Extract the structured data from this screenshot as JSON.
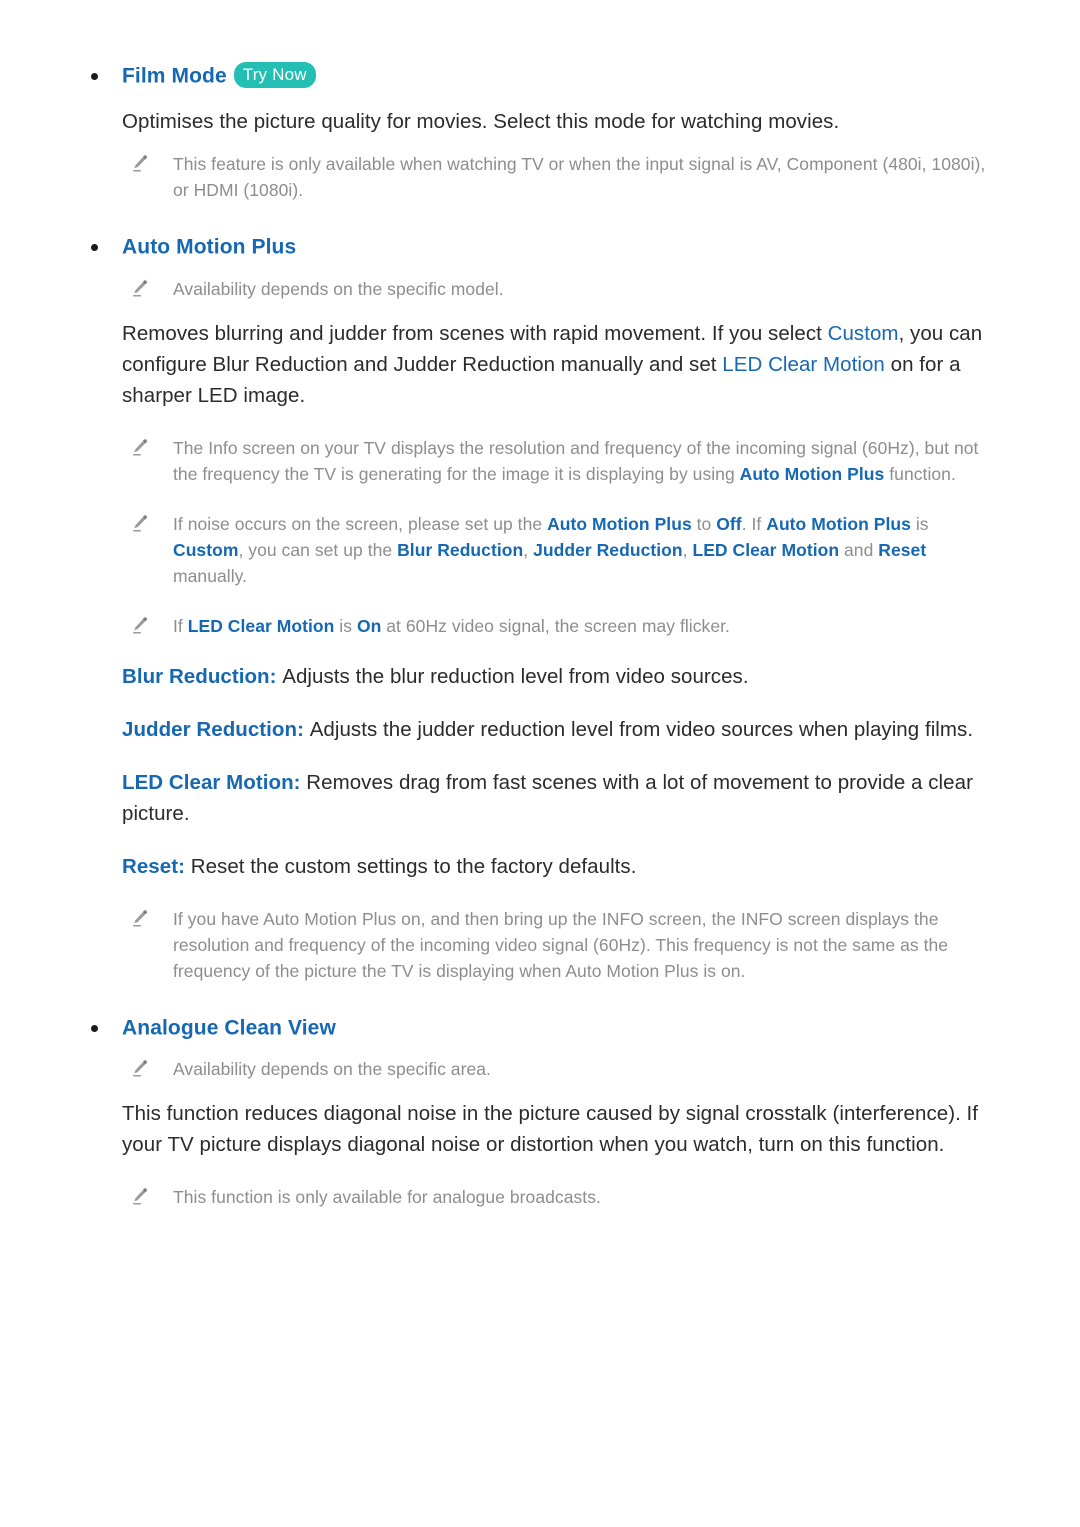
{
  "document": {
    "type": "tv-e-manual-page",
    "colors": {
      "accent_blue": "#1668b3",
      "badge_teal": "#23bfb3",
      "body_text": "#2b2b2b",
      "note_text": "#8d8d8d",
      "background": "#ffffff"
    }
  },
  "sections": [
    {
      "id": "film-mode",
      "heading": "Film Mode",
      "badge": "Try Now",
      "badge_icon": "try-now-badge",
      "body": "Optimises the picture quality for movies. Select this mode for watching movies.",
      "notes": [
        {
          "icon": "pencil-note-icon",
          "parts": [
            {
              "text": "This feature is only available when watching TV or when the input signal is AV, Component (480i, 1080i), or HDMI (1080i).",
              "style": "plain"
            }
          ]
        }
      ]
    },
    {
      "id": "auto-motion-plus",
      "heading": "Auto Motion Plus",
      "badge": null,
      "pre_notes": [
        {
          "icon": "pencil-note-icon",
          "parts": [
            {
              "text": "Availability depends on the specific model.",
              "style": "plain"
            }
          ]
        }
      ],
      "body_parts": [
        {
          "text": "Removes blurring and judder from scenes with rapid movement. If you select ",
          "style": "plain"
        },
        {
          "text": "Custom",
          "style": "blue"
        },
        {
          "text": ", you can configure Blur Reduction and Judder Reduction manually and set ",
          "style": "plain"
        },
        {
          "text": "LED Clear Motion",
          "style": "blue"
        },
        {
          "text": " on for a sharper LED image.",
          "style": "plain"
        }
      ],
      "notes": [
        {
          "icon": "pencil-note-icon",
          "parts": [
            {
              "text": "The Info screen on your TV displays the resolution and frequency of the incoming signal (60Hz), but not the frequency the TV is generating for the image it is displaying by using ",
              "style": "plain"
            },
            {
              "text": "Auto Motion Plus",
              "style": "blue-bold"
            },
            {
              "text": " function.",
              "style": "plain"
            }
          ]
        },
        {
          "icon": "pencil-note-icon",
          "parts": [
            {
              "text": "If noise occurs on the screen, please set up the ",
              "style": "plain"
            },
            {
              "text": "Auto Motion Plus",
              "style": "blue-bold"
            },
            {
              "text": " to ",
              "style": "plain"
            },
            {
              "text": "Off",
              "style": "blue-bold"
            },
            {
              "text": ". If ",
              "style": "plain"
            },
            {
              "text": "Auto Motion Plus",
              "style": "blue-bold"
            },
            {
              "text": " is ",
              "style": "plain"
            },
            {
              "text": "Custom",
              "style": "blue-bold"
            },
            {
              "text": ", you can set up the ",
              "style": "plain"
            },
            {
              "text": "Blur Reduction",
              "style": "blue-bold"
            },
            {
              "text": ", ",
              "style": "plain"
            },
            {
              "text": "Judder Reduction",
              "style": "blue-bold"
            },
            {
              "text": ", ",
              "style": "plain"
            },
            {
              "text": "LED Clear Motion",
              "style": "blue-bold"
            },
            {
              "text": " and ",
              "style": "plain"
            },
            {
              "text": "Reset",
              "style": "blue-bold"
            },
            {
              "text": " manually.",
              "style": "plain"
            }
          ]
        },
        {
          "icon": "pencil-note-icon",
          "parts": [
            {
              "text": "If ",
              "style": "plain"
            },
            {
              "text": "LED Clear Motion",
              "style": "blue-bold"
            },
            {
              "text": " is ",
              "style": "plain"
            },
            {
              "text": "On",
              "style": "blue-bold"
            },
            {
              "text": " at 60Hz video signal, the screen may flicker.",
              "style": "plain"
            }
          ]
        }
      ],
      "definitions": [
        {
          "term": "Blur Reduction",
          "separator": ": ",
          "description": "Adjusts the blur reduction level from video sources."
        },
        {
          "term": "Judder Reduction",
          "separator": ": ",
          "description": "Adjusts the judder reduction level from video sources when playing films."
        },
        {
          "term": "LED Clear Motion",
          "separator": ": ",
          "description": "Removes drag from fast scenes with a lot of movement to provide a clear picture."
        },
        {
          "term": "Reset",
          "separator": ": ",
          "description": "Reset the custom settings to the factory defaults."
        }
      ],
      "trailing_notes": [
        {
          "icon": "pencil-note-icon",
          "parts": [
            {
              "text": "If you have Auto Motion Plus on, and then bring up the INFO screen, the INFO screen displays the resolution and frequency of the incoming video signal (60Hz). This frequency is not the same as the frequency of the picture the TV is displaying when Auto Motion Plus is on.",
              "style": "plain"
            }
          ]
        }
      ]
    },
    {
      "id": "analogue-clean-view",
      "heading": "Analogue Clean View",
      "badge": null,
      "pre_notes": [
        {
          "icon": "pencil-note-icon",
          "parts": [
            {
              "text": "Availability depends on the specific area.",
              "style": "plain"
            }
          ]
        }
      ],
      "body": "This function reduces diagonal noise in the picture caused by signal crosstalk (interference). If your TV picture displays diagonal noise or distortion when you watch, turn on this function.",
      "notes": [
        {
          "icon": "pencil-note-icon",
          "parts": [
            {
              "text": "This function is only available for analogue broadcasts.",
              "style": "plain"
            }
          ]
        }
      ]
    }
  ]
}
